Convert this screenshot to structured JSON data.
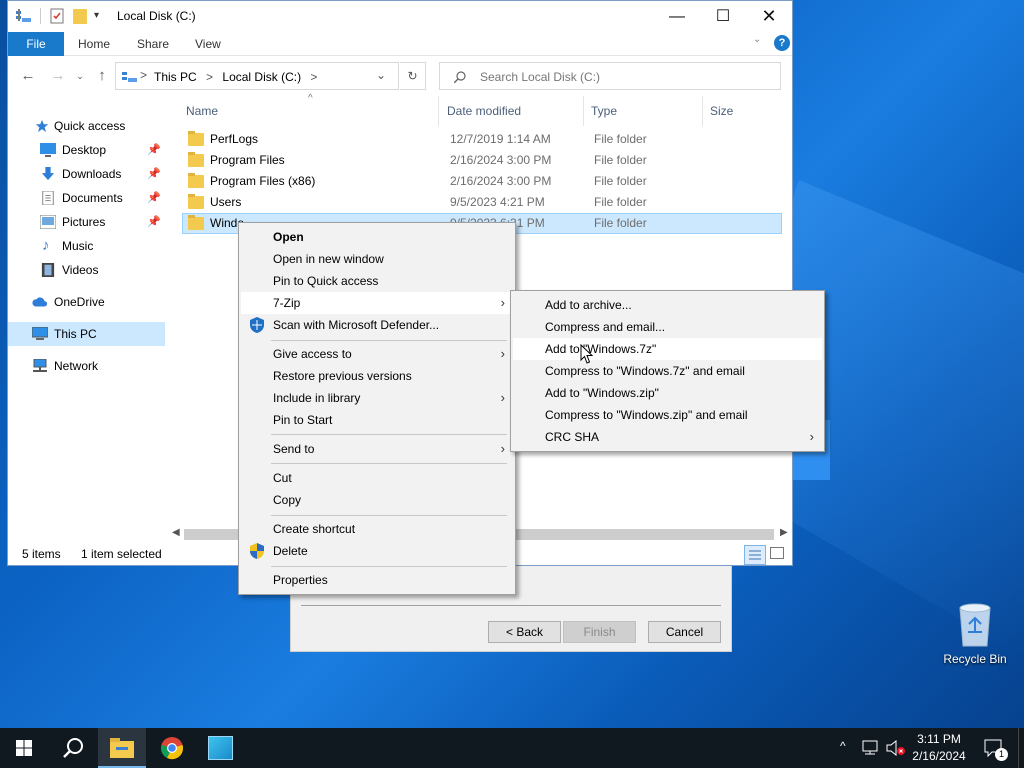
{
  "window": {
    "title": "Local Disk (C:)",
    "tabs": {
      "file": "File",
      "home": "Home",
      "share": "Share",
      "view": "View"
    },
    "help": "?",
    "address": {
      "this_pc": "This PC",
      "sep": ">",
      "location": "Local Disk (C:)"
    },
    "search_placeholder": "Search Local Disk (C:)"
  },
  "sidebar": {
    "items": [
      {
        "label": "Quick access",
        "icon": "star-icon"
      },
      {
        "label": "Desktop",
        "icon": "desktop-icon",
        "pinned": true
      },
      {
        "label": "Downloads",
        "icon": "download-icon",
        "pinned": true
      },
      {
        "label": "Documents",
        "icon": "documents-icon",
        "pinned": true
      },
      {
        "label": "Pictures",
        "icon": "pictures-icon",
        "pinned": true
      },
      {
        "label": "Music",
        "icon": "music-icon"
      },
      {
        "label": "Videos",
        "icon": "videos-icon"
      },
      {
        "label": "OneDrive",
        "icon": "cloud-icon"
      },
      {
        "label": "This PC",
        "icon": "computer-icon",
        "selected": true
      },
      {
        "label": "Network",
        "icon": "network-icon"
      }
    ]
  },
  "columns": {
    "name": "Name",
    "date": "Date modified",
    "type": "Type",
    "size": "Size"
  },
  "files": [
    {
      "name": "PerfLogs",
      "date": "12/7/2019 1:14 AM",
      "type": "File folder"
    },
    {
      "name": "Program Files",
      "date": "2/16/2024 3:00 PM",
      "type": "File folder"
    },
    {
      "name": "Program Files (x86)",
      "date": "2/16/2024 3:00 PM",
      "type": "File folder"
    },
    {
      "name": "Users",
      "date": "9/5/2023 4:21 PM",
      "type": "File folder"
    },
    {
      "name": "Windo",
      "date": "9/5/2023 6:31 PM",
      "type": "File folder",
      "selected": true
    }
  ],
  "status": {
    "count": "5 items",
    "selected": "1 item selected"
  },
  "context_menu": {
    "items": [
      {
        "label": "Open",
        "bold": true
      },
      {
        "label": "Open in new window"
      },
      {
        "label": "Pin to Quick access"
      },
      {
        "label": "7-Zip",
        "submenu": true,
        "highlighted": true
      },
      {
        "label": "Scan with Microsoft Defender..."
      },
      {
        "label": "Give access to",
        "submenu": true
      },
      {
        "label": "Restore previous versions"
      },
      {
        "label": "Include in library",
        "submenu": true
      },
      {
        "label": "Pin to Start"
      },
      {
        "label": "Send to",
        "submenu": true
      },
      {
        "label": "Cut"
      },
      {
        "label": "Copy"
      },
      {
        "label": "Create shortcut"
      },
      {
        "label": "Delete"
      },
      {
        "label": "Properties"
      }
    ]
  },
  "zip_menu": {
    "items": [
      {
        "label": "Add to archive..."
      },
      {
        "label": "Compress and email..."
      },
      {
        "label": "Add to \"Windows.7z\"",
        "highlighted": true
      },
      {
        "label": "Compress to \"Windows.7z\" and email"
      },
      {
        "label": "Add to \"Windows.zip\""
      },
      {
        "label": "Compress to \"Windows.zip\" and email"
      },
      {
        "label": "CRC SHA",
        "submenu": true
      }
    ]
  },
  "wizard": {
    "back": "< Back",
    "finish": "Finish",
    "cancel": "Cancel"
  },
  "desktop": {
    "recycle_bin": "Recycle Bin"
  },
  "taskbar": {
    "time": "3:11 PM",
    "date": "2/16/2024",
    "notifications": "1"
  },
  "colors": {
    "accent": "#1979ca",
    "selection": "#cce8ff",
    "taskbar": "#101820"
  }
}
